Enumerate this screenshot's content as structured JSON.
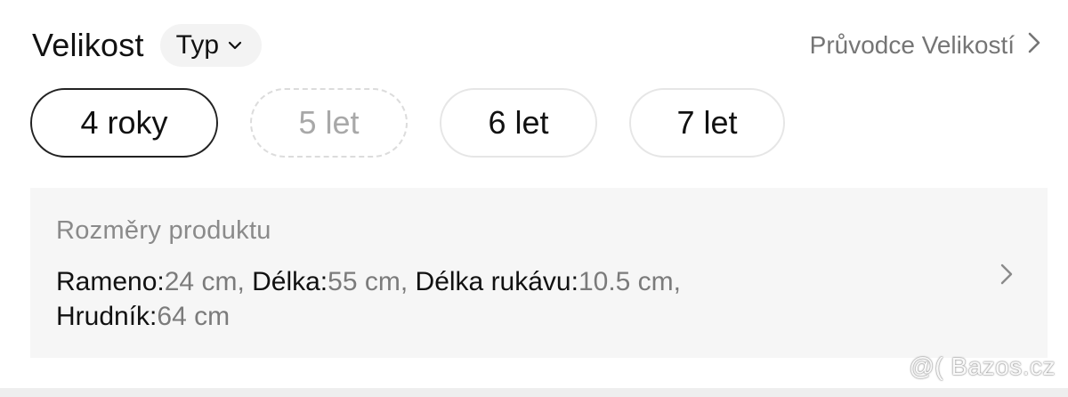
{
  "header": {
    "title": "Velikost",
    "type_label": "Typ",
    "guide_label": "Průvodce Velikostí"
  },
  "sizes": [
    {
      "label": "4 roky",
      "state": "selected"
    },
    {
      "label": "5 let",
      "state": "unavailable"
    },
    {
      "label": "6 let",
      "state": "available"
    },
    {
      "label": "7 let",
      "state": "available"
    }
  ],
  "dimensions": {
    "title": "Rozměry produktu",
    "items": [
      {
        "label": "Rameno:",
        "value": "24 cm",
        "sep": ", "
      },
      {
        "label": "Délka:",
        "value": "55 cm",
        "sep": ", "
      },
      {
        "label": "Délka rukávu:",
        "value": "10.5 cm",
        "sep": ","
      },
      {
        "label": "Hrudník:",
        "value": "64 cm",
        "sep": ""
      }
    ]
  },
  "watermark": "@( Bazos.cz",
  "icons": {
    "type_chevron": "chevron-down-icon",
    "guide_chevron": "chevron-right-icon",
    "dims_chevron": "chevron-right-icon"
  }
}
